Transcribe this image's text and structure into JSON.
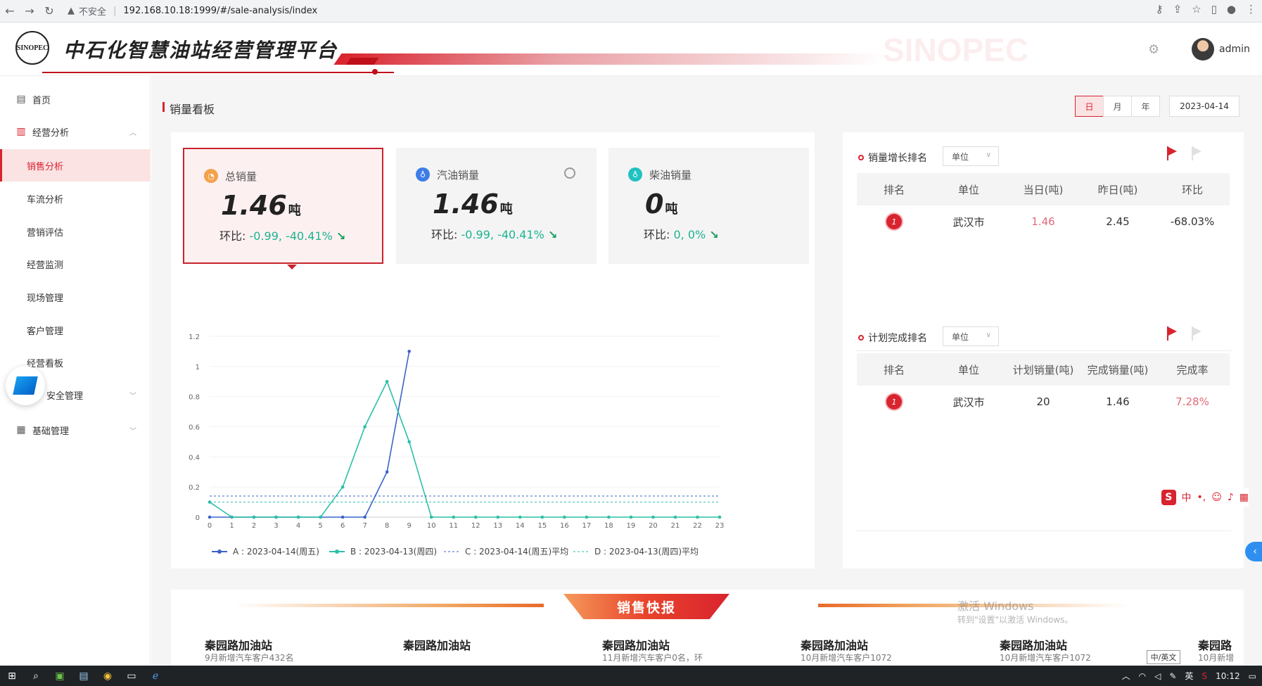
{
  "browser": {
    "insecure_label": "不安全",
    "url": "192.168.10.18:1999/#/sale-analysis/index"
  },
  "header": {
    "logo_text": "SINOPEC",
    "app_title": "中石化智慧油站经营管理平台",
    "brand_watermark": "SINOPEC",
    "username": "admin"
  },
  "sidebar": {
    "items": [
      {
        "label": "首页",
        "icon": "home-icon"
      },
      {
        "label": "经营分析",
        "icon": "chart-icon"
      },
      {
        "label": "销售分析"
      },
      {
        "label": "车流分析"
      },
      {
        "label": "营销评估"
      },
      {
        "label": "经营监测"
      },
      {
        "label": "现场管理"
      },
      {
        "label": "客户管理"
      },
      {
        "label": "经营看板"
      },
      {
        "label": "安全管理"
      },
      {
        "label": "基础管理",
        "icon": "grid-icon"
      }
    ]
  },
  "main": {
    "title": "销量看板",
    "periods": [
      "日",
      "月",
      "年"
    ],
    "active_period": "日",
    "date": "2023-04-14"
  },
  "kpis": [
    {
      "label": "总销量",
      "value": "1.46",
      "unit": "吨",
      "ratio_label": "环比:",
      "ratio": "-0.99, -40.41%",
      "icon_color": "#f3a24b"
    },
    {
      "label": "汽油销量",
      "value": "1.46",
      "unit": "吨",
      "ratio_label": "环比:",
      "ratio": "-0.99, -40.41%",
      "icon_color": "#3c7de6"
    },
    {
      "label": "柴油销量",
      "value": "0",
      "unit": "吨",
      "ratio_label": "环比:",
      "ratio": "0, 0%",
      "icon_color": "#1fc1c1"
    }
  ],
  "chart_data": {
    "type": "line",
    "x": [
      0,
      1,
      2,
      3,
      4,
      5,
      6,
      7,
      8,
      9,
      10,
      11,
      12,
      13,
      14,
      15,
      16,
      17,
      18,
      19,
      20,
      21,
      22,
      23
    ],
    "ylim": [
      0,
      1.2
    ],
    "yticks": [
      0,
      0.2,
      0.4,
      0.6,
      0.8,
      1,
      1.2
    ],
    "series": [
      {
        "name": "A : 2023-04-14(周五)",
        "color": "#3b63c9",
        "values": [
          0,
          0,
          0,
          0,
          0,
          0,
          0,
          0,
          0.3,
          1.1,
          null,
          null,
          null,
          null,
          null,
          null,
          null,
          null,
          null,
          null,
          null,
          null,
          null,
          null
        ]
      },
      {
        "name": "B : 2023-04-13(周四)",
        "color": "#2cbfa8",
        "values": [
          0.1,
          0,
          0,
          0,
          0,
          0,
          0.2,
          0.6,
          0.9,
          0.5,
          0,
          0,
          0,
          0,
          0,
          0,
          0,
          0,
          0,
          0,
          0,
          0,
          0,
          0
        ]
      },
      {
        "name": "C : 2023-04-14(周五)平均",
        "color": "#3b63c9",
        "dashed": true,
        "values": [
          0.14
        ]
      },
      {
        "name": "D : 2023-04-13(周四)平均",
        "color": "#2cbfa8",
        "dashed": true,
        "values": [
          0.1
        ]
      }
    ]
  },
  "growth_rank": {
    "title": "销量增长排名",
    "unit_select": "单位",
    "headers": [
      "排名",
      "单位",
      "当日(吨)",
      "昨日(吨)",
      "环比"
    ],
    "rows": [
      [
        "1",
        "武汉市",
        "1.46",
        "2.45",
        "-68.03%"
      ]
    ]
  },
  "plan_rank": {
    "title": "计划完成排名",
    "unit_select": "单位",
    "headers": [
      "排名",
      "单位",
      "计划销量(吨)",
      "完成销量(吨)",
      "完成率"
    ],
    "rows": [
      [
        "1",
        "武汉市",
        "20",
        "1.46",
        "7.28%"
      ]
    ]
  },
  "flash": {
    "title": "销售快报",
    "items": [
      {
        "name": "秦园路加油站",
        "sub": "9月新增汽车客户432名"
      },
      {
        "name": "秦园路加油站",
        "sub": ""
      },
      {
        "name": "秦园路加油站",
        "sub": "11月新增汽车客户0名，环"
      },
      {
        "name": "秦园路加油站",
        "sub": "10月新增汽车客户1072"
      },
      {
        "name": "秦园路加油站",
        "sub": "10月新增汽车客户1072"
      },
      {
        "name": "秦园路",
        "sub": "10月新增"
      }
    ]
  },
  "windows": {
    "activate_title": "激活 Windows",
    "activate_sub": "转到\"设置\"以激活 Windows。",
    "lang": "中/英文",
    "ime_label": "中",
    "clock": "10:12",
    "input_lang": "英"
  }
}
